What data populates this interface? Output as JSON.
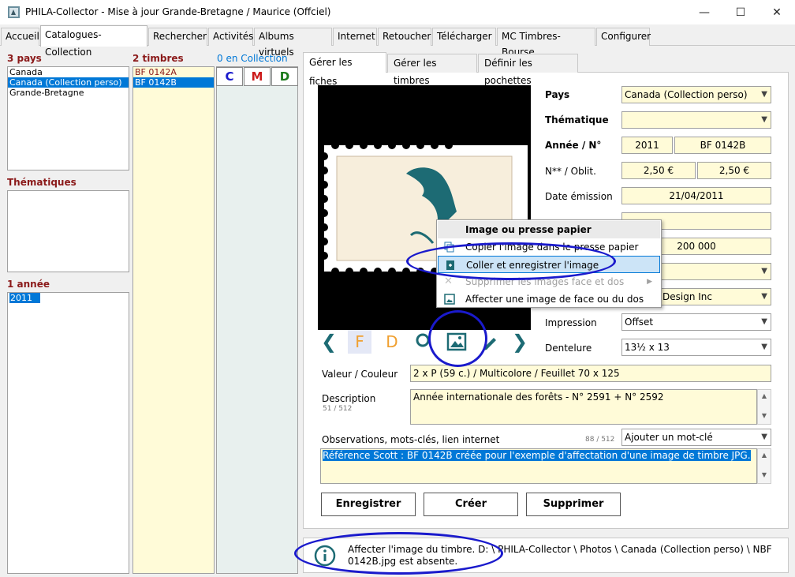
{
  "window": {
    "title": "PHILA-Collector - Mise à jour Grande-Bretagne / Maurice (Offciel)",
    "minimize": "—",
    "maximize": "☐",
    "close": "✕"
  },
  "menu_tabs": [
    "Accueil",
    "Catalogues-Collection",
    "Rechercher",
    "Activités",
    "Albums virtuels",
    "Internet",
    "Retoucher",
    "Télécharger",
    "MC Timbres-Bourse",
    "Configurer"
  ],
  "left": {
    "countries_title": "3 pays",
    "countries": [
      "Canada",
      "Canada (Collection perso)",
      "Grande-Bretagne"
    ],
    "themes_title": "Thématiques",
    "years_title": "1 année",
    "years": [
      "2011"
    ],
    "stamps_title": "2 timbres",
    "stamps": [
      "BF 0142A",
      "BF 0142B"
    ],
    "collection_title": "0 en Collection",
    "cmd_c": "C",
    "cmd_m": "M",
    "cmd_d": "D"
  },
  "subtabs": [
    "Gérer les fiches",
    "Gérer les timbres",
    "Définir les pochettes"
  ],
  "form": {
    "pays_label": "Pays",
    "pays_value": "Canada (Collection perso)",
    "thematique_label": "Thématique",
    "thematique_value": "",
    "annee_label": "Année / N°",
    "annee_value": "2011",
    "numero_value": "BF 0142B",
    "cote_label": "N** / Oblit.",
    "cote_neuf": "2,50 €",
    "cote_oblit": "2,50 €",
    "date_label": "Date émission",
    "date_value": "21/04/2011",
    "tirage_value": "200 000",
    "design_value": "Design Inc",
    "impression_label": "Impression",
    "impression_value": "Offset",
    "dentelure_label": "Dentelure",
    "dentelure_value": "13½ x 13",
    "valeur_label": "Valeur / Couleur",
    "valeur_value": "2 x P (59 c.) / Multicolore / Feuillet 70 x 125",
    "description_label": "Description",
    "description_count": "51 / 512",
    "description_value": "Année internationale des forêts - N° 2591 + N° 2592",
    "observations_label": "Observations, mots-clés, lien internet",
    "observations_count": "88 / 512",
    "motcle_placeholder": "Ajouter un mot-clé",
    "observations_value": "Référence Scott : BF 0142B créée pour l'exemple d'affectation d'une image de timbre JPG."
  },
  "image_toolbar": {
    "prev": "❮",
    "face": "F",
    "dos": "D",
    "next": "❯"
  },
  "buttons": {
    "save": "Enregistrer",
    "create": "Créer",
    "delete": "Supprimer"
  },
  "context_menu": {
    "header": "Image ou presse papier",
    "items": [
      "Copier l'image dans le presse papier",
      "Coller et enregistrer l'image",
      "Supprimer les images face et dos",
      "Affecter une image de face ou du dos"
    ]
  },
  "status": {
    "message_line1": "Affecter l'image du timbre. D: \\ PHILA-Collector \\ Photos \\ Canada (Collection perso) \\ NBF",
    "message_line2": "0142B.jpg est absente."
  },
  "colors": {
    "accent": "#0078d7",
    "section_title": "#8b1a1a",
    "field_bg": "#fffbd8",
    "annotation": "#1a1acc",
    "icon_teal": "#1d6b74",
    "face_orange": "#f0a030"
  }
}
